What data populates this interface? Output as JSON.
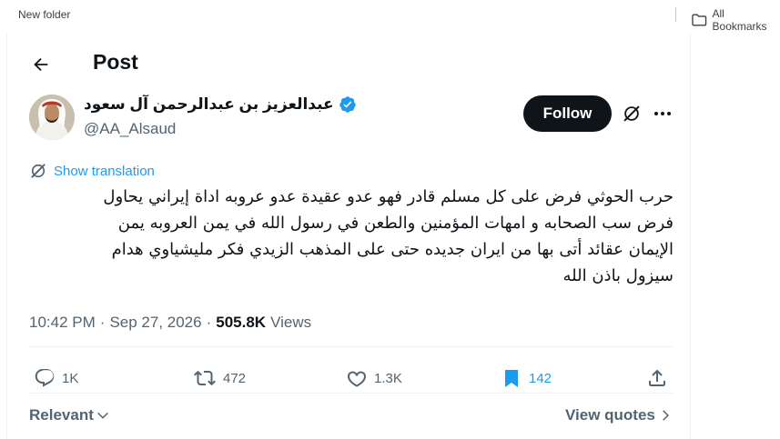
{
  "bookmarks_bar": {
    "left_item": "New folder",
    "right_item": "All Bookmarks"
  },
  "header": {
    "back_icon": "arrow-left-icon",
    "title": "Post"
  },
  "author": {
    "name": "عبدالعزيز بن عبدالرحمن آل سعود",
    "handle": "@AA_Alsaud",
    "verified_color": "#1d9bf0",
    "follow_label": "Follow"
  },
  "translate": {
    "label": "Show translation",
    "icon": "translate-icon"
  },
  "tweet": {
    "lines": [
      "حرب الحوثي فرض على كل مسلم قادر فهو عدو عقيدة عدو عروبه اداة إيراني يحاول",
      "فرض سب الصحابه و امهات المؤمنين والطعن في رسول الله في يمن العروبه يمن",
      "الإيمان عقائد أتى بها من ايران جديده حتى على المذهب الزيدي فكر مليشياوي هدام",
      "سيزول باذن الله"
    ]
  },
  "meta": {
    "time": "10:42 PM",
    "dot1": "·",
    "date": "Sep 27, 2026",
    "dot2": "·",
    "views_count": "505.8K",
    "views_label": "Views"
  },
  "actions": {
    "replies": "1K",
    "reposts": "472",
    "likes": "1.3K",
    "bookmarks": "142"
  },
  "replies_filter": {
    "label": "Relevant",
    "view_quotes": "View quotes"
  },
  "colors": {
    "accent": "#1d9bf0",
    "text_primary": "#0f1419",
    "text_secondary": "#536471",
    "follow_bg": "#0f1419"
  }
}
